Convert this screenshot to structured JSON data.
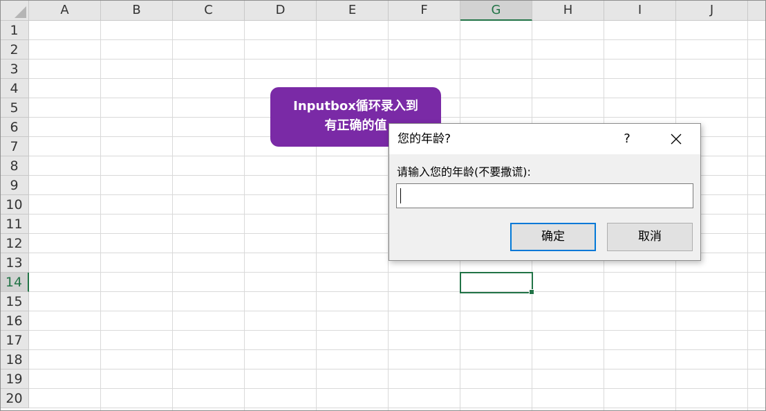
{
  "sheet": {
    "columns": [
      "A",
      "B",
      "C",
      "D",
      "E",
      "F",
      "G",
      "H",
      "I",
      "J"
    ],
    "rows": [
      "1",
      "2",
      "3",
      "4",
      "5",
      "6",
      "7",
      "8",
      "9",
      "10",
      "11",
      "12",
      "13",
      "14",
      "15",
      "16",
      "17",
      "18",
      "19",
      "20"
    ],
    "selected_column": "G",
    "selected_row": "14",
    "grid_color": "#d9d9d9",
    "header_bg": "#e6e6e6",
    "accent_color": "#217346"
  },
  "callout": {
    "line1": "Inputbox循环录入到",
    "line2": "有正确的值",
    "color": "#7a2aa6"
  },
  "dialog": {
    "title": "您的年龄?",
    "help_label": "?",
    "prompt": "请输入您的年龄(不要撒谎):",
    "input_value": "",
    "ok_label": "确定",
    "cancel_label": "取消",
    "focus_color": "#0078d7"
  }
}
